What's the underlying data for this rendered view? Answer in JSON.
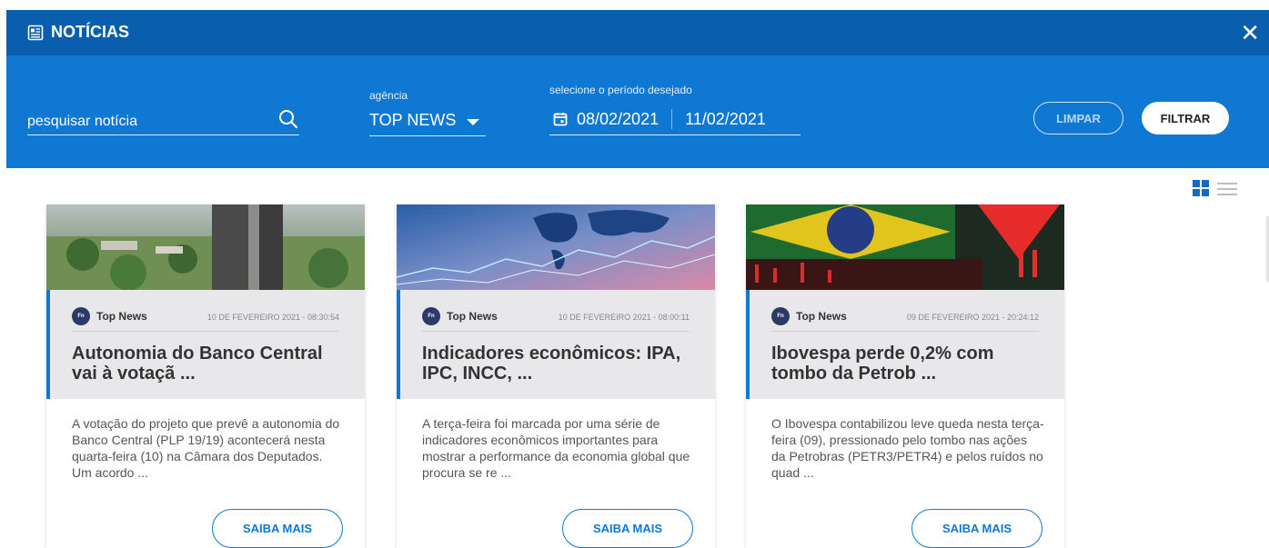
{
  "header": {
    "title": "NOTÍCIAS",
    "close": "✕"
  },
  "filters": {
    "search_placeholder": "pesquisar notícia",
    "agency_label": "agência",
    "agency_value": "TOP NEWS",
    "period_label": "selecione o período desejado",
    "date_from": "08/02/2021",
    "date_to": "11/02/2021",
    "clear_label": "LIMPAR",
    "filter_label": "FILTRAR"
  },
  "colors": {
    "header": "#0a5eae",
    "filter_bar": "#0f78d2",
    "accent": "#0f78d2"
  },
  "cards": [
    {
      "agency": "Top News",
      "logo_text": "Fn",
      "date": "10 DE FEVEREIRO 2021 - 08:30:54",
      "title": "Autonomia do Banco Central vai à votaçã ...",
      "summary": "A votação do projeto que prevê a autonomia do Banco Central (PLP 19/19) acontecerá nesta quarta-feira (10) na Câmara dos Deputados. Um acordo ...",
      "button": "SAIBA MAIS"
    },
    {
      "agency": "Top News",
      "logo_text": "Fn",
      "date": "10 DE FEVEREIRO 2021 - 08:00:11",
      "title": "Indicadores econômicos: IPA, IPC, INCC, ...",
      "summary": "A terça-feira foi marcada por uma série de indicadores econômicos importantes para mostrar a performance da economia global que procura se re ...",
      "button": "SAIBA MAIS"
    },
    {
      "agency": "Top News",
      "logo_text": "Fn",
      "date": "09 DE FEVEREIRO 2021 - 20:24:12",
      "title": "Ibovespa perde 0,2% com tombo da Petrob ...",
      "summary": "O Ibovespa contabilizou leve queda nesta terça-feira (09), pressionado pelo tombo nas ações da Petrobras (PETR3/PETR4) e pelos ruídos no quad ...",
      "button": "SAIBA MAIS"
    }
  ]
}
